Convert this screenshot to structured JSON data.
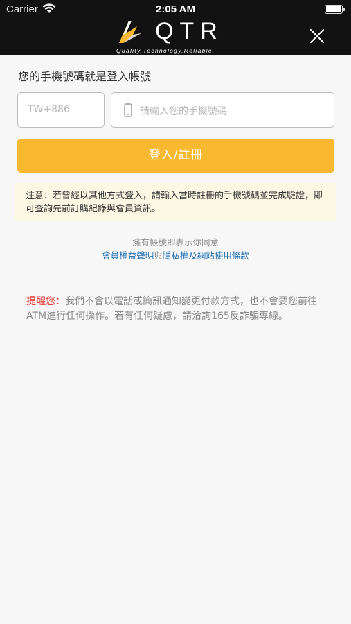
{
  "status_bar": {
    "carrier": "Carrier",
    "time": "2:05 AM"
  },
  "header": {
    "brand_word": "QTR",
    "brand_tagline": "Quality.Technology.Reliable."
  },
  "form": {
    "label": "您的手機號碼就是登入帳號",
    "country_code_placeholder": "TW+886",
    "phone_placeholder": "請輸入您的手機號碼",
    "submit_label": "登入/註冊"
  },
  "notice": {
    "text": "注意：若曾經以其他方式登入，請輸入當時註冊的手機號碼並完成驗證，即可查詢先前訂購紀錄與會員資訊。"
  },
  "agreement": {
    "prefix": "擁有帳號即表示你同意",
    "link1": "會員權益聲明",
    "and": "與",
    "link2": "隱私權及網站使用條款"
  },
  "reminder": {
    "highlight": "提醒您：",
    "text": "我們不會以電話或簡訊通知變更付款方式，也不會要您前往ATM進行任何操作。若有任何疑慮，請洽詢165反詐騙專線。"
  },
  "colors": {
    "header_bg": "#121212",
    "accent": "#f8b830",
    "link": "#1f6fb5",
    "warning": "#e53935",
    "notice_bg": "#fdf8e4"
  }
}
